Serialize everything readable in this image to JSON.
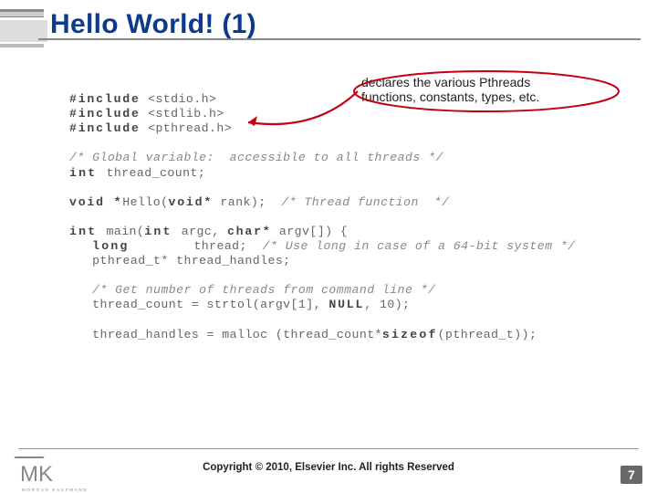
{
  "title": "Hello World! (1)",
  "callout_line1": "declares the various Pthreads",
  "callout_line2": "functions, constants, types, etc.",
  "code": {
    "l1a": "#include",
    "l1b": " <stdio.h>",
    "l2a": "#include",
    "l2b": " <stdlib.h>",
    "l3a": "#include",
    "l3b": " <pthread.h>",
    "l4": "/* Global variable:  accessible to all threads */",
    "l5a": "int ",
    "l5b": "thread_count;",
    "l6a": "void *",
    "l6b": "Hello(",
    "l6c": "void*",
    "l6d": " rank);  ",
    "l6e": "/* Thread function  */",
    "l7a": "int ",
    "l7b": "main(",
    "l7c": "int ",
    "l7d": "argc, ",
    "l7e": "char*",
    "l7f": " argv[]) {",
    "l8a": "long       ",
    "l8b": "thread;  ",
    "l8c": "/* Use long in case of a 64-bit system */",
    "l9": "   pthread_t* thread_handles;",
    "l10": "/* Get number of threads from command line */",
    "l11a": "   thread_count = strtol(argv[1], ",
    "l11b": "NULL",
    "l11c": ", 10);",
    "l12a": "   thread_handles = malloc (thread_count*",
    "l12b": "sizeof",
    "l12c": "(pthread_t));"
  },
  "footer": {
    "logo_letters": "MK",
    "logo_sub": "MORGAN KAUFMANN",
    "copyright": "Copyright © 2010, Elsevier Inc. All rights Reserved",
    "page_number": "7"
  }
}
